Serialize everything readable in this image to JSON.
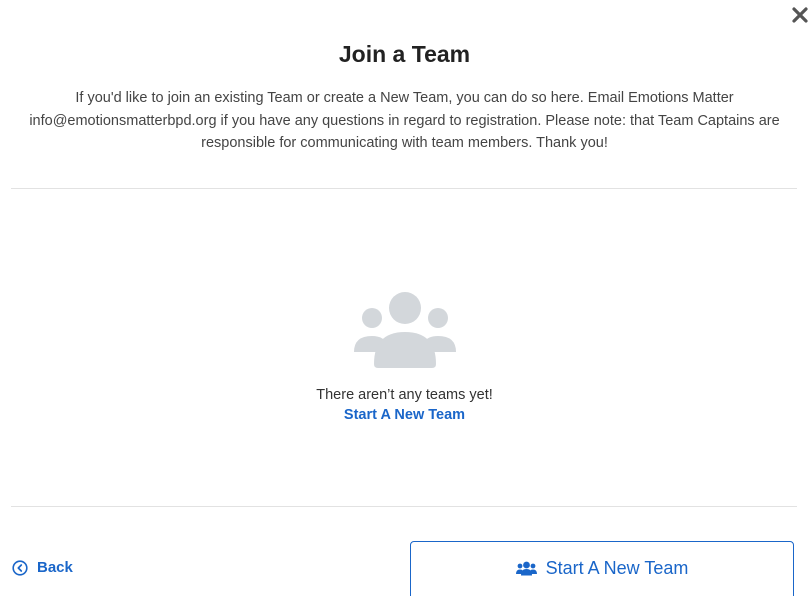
{
  "modal": {
    "close_icon": "close-icon",
    "title": "Join a Team",
    "description": "If you'd like to join an existing Team or create a New Team, you can do so here. Email Emotions Matter info@emotionsmatterbpd.org if you have any questions in regard to registration. Please note: that Team Captains are responsible for communicating with team members. Thank you!"
  },
  "empty_state": {
    "icon": "people-group-icon",
    "message": "There aren’t any teams yet!",
    "link_label": "Start A New Team"
  },
  "footer": {
    "back_label": "Back",
    "back_icon": "chevron-left-circle-icon",
    "start_button_label": "Start A New Team",
    "start_button_icon": "users-icon"
  },
  "colors": {
    "accent": "#1a66c9",
    "icon_gray": "#d3d7db",
    "divider": "#e2e2e2"
  }
}
